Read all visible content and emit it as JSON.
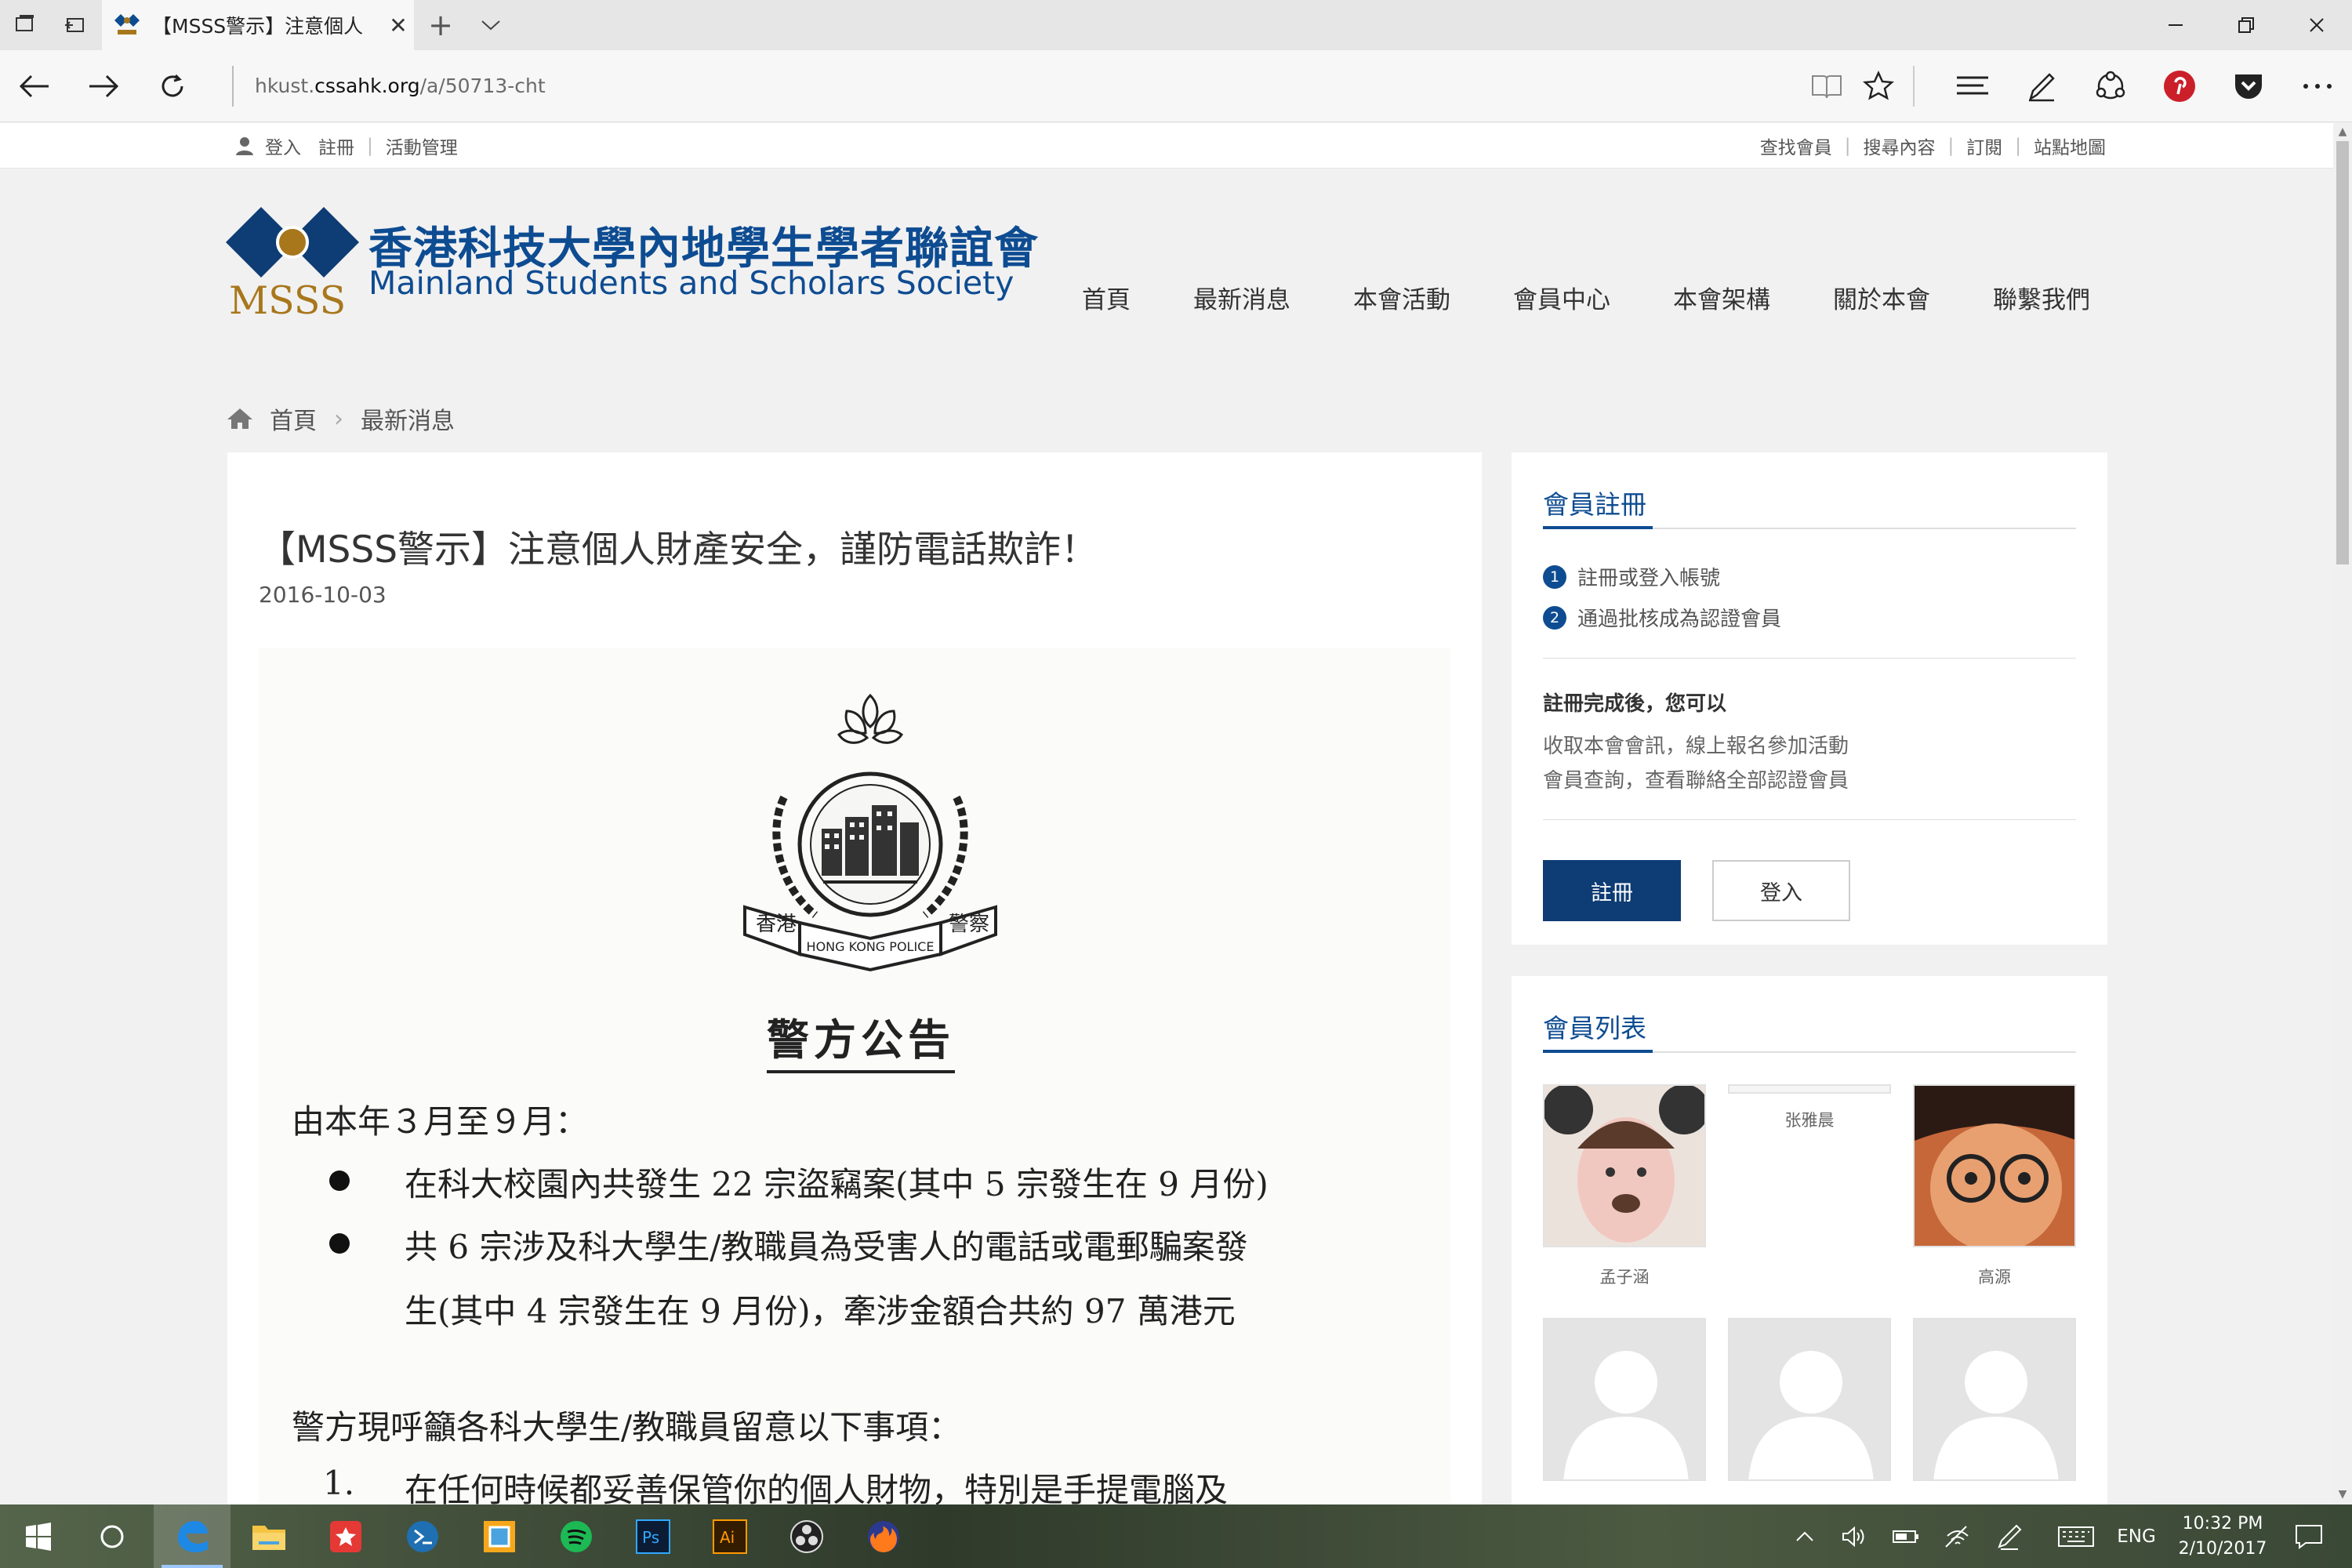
{
  "browser": {
    "tab_title": "【MSSS警示】注意個人",
    "url_host": "hkust.",
    "url_domain": "cssahk.org",
    "url_path": "/a/50713-cht",
    "new_tab_glyph": "+",
    "close_tab_glyph": "✕"
  },
  "topbar": {
    "left": [
      "登入",
      "註冊",
      "活動管理"
    ],
    "right": [
      "查找會員",
      "搜尋內容",
      "訂閱",
      "站點地圖"
    ]
  },
  "logo": {
    "abbr": "MSSS",
    "name_cn": "香港科技大學內地學生學者聯誼會",
    "name_en": "Mainland Students and Scholars Society"
  },
  "nav": [
    "首頁",
    "最新消息",
    "本會活動",
    "會員中心",
    "本會架構",
    "關於本會",
    "聯繫我們"
  ],
  "breadcrumb": [
    "首頁",
    "最新消息"
  ],
  "article": {
    "title": "【MSSS警示】注意個人財產安全，謹防電話欺詐！",
    "date": "2016-10-03",
    "notice": {
      "badge_left": "香港",
      "badge_right": "警察",
      "badge_ribbon": "HONG KONG POLICE",
      "heading": "警方公告",
      "line1": "由本年３月至９月：",
      "bullet1": "在科大校園內共發生 22 宗盜竊案(其中 5 宗發生在 9 月份)",
      "bullet2a": "共 6 宗涉及科大學生/教職員為受害人的電話或電郵騙案發",
      "bullet2b": "生(其中 4 宗發生在 9 月份)，牽涉金額合共約 97 萬港元",
      "line2": "警方現呼籲各科大學生/教職員留意以下事項：",
      "item1_num": "1.",
      "item1": "在任何時候都妥善保管你的個人財物，特別是手提電腦及"
    }
  },
  "sidebar": {
    "register": {
      "title": "會員註冊",
      "steps": [
        {
          "num": "1",
          "text": "註冊或登入帳號"
        },
        {
          "num": "2",
          "text": "通過批核成為認證會員"
        }
      ],
      "after_title": "註冊完成後，您可以",
      "after_lines": [
        "收取本會會訊，線上報名參加活動",
        "會員查詢，查看聯絡全部認證會員"
      ],
      "register_btn": "註冊",
      "login_btn": "登入"
    },
    "members": {
      "title": "會員列表",
      "list": [
        {
          "name": "孟子涵"
        },
        {
          "name": "张雅晨"
        },
        {
          "name": "高源"
        }
      ]
    }
  },
  "taskbar": {
    "lang": "ENG",
    "time": "10:32 PM",
    "date": "2/10/2017",
    "apps": [
      "windows-start",
      "cortana",
      "edge",
      "file-explorer",
      "wps",
      "cmd",
      "vmware",
      "spotify",
      "photoshop",
      "illustrator",
      "obs",
      "firefox"
    ]
  },
  "colors": {
    "brand": "#0e4c92",
    "button": "#0e3c74",
    "gold": "#a8771c",
    "chat": "#6d1a7c"
  }
}
